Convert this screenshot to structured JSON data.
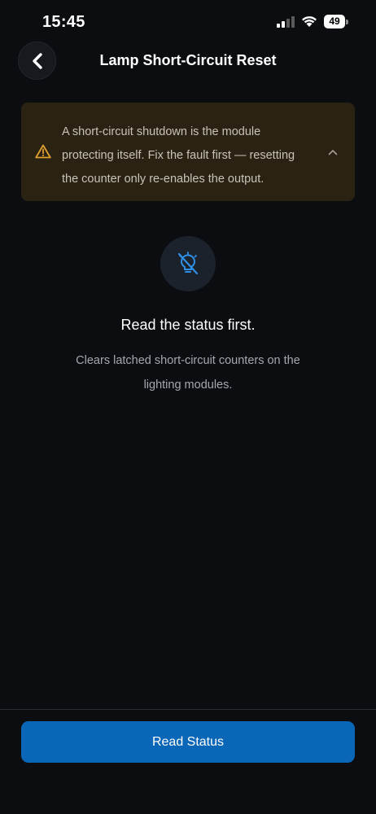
{
  "status_bar": {
    "time": "15:45",
    "battery_level": "49",
    "icons": [
      "signal-icon",
      "wifi-icon",
      "battery-icon"
    ]
  },
  "header": {
    "title": "Lamp Short-Circuit Reset",
    "back_icon": "chevron-left-icon"
  },
  "warning": {
    "text": "A short-circuit shutdown is the module protecting itself. Fix the fault first — resetting the counter only re-enables the output.",
    "icon": "warning-triangle-icon",
    "toggle_icon": "chevron-up-icon",
    "accent_color": "#e0a030",
    "background_color": "#2a2212"
  },
  "main": {
    "status_icon": "bulb-off-icon",
    "title": "Read the status first.",
    "description": "Clears latched short-circuit counters on the lighting modules."
  },
  "footer": {
    "primary_button_label": "Read Status",
    "primary_color": "#0a66b6"
  },
  "colors": {
    "background": "#0b0d10",
    "icon_blue": "#2f8fe6"
  }
}
